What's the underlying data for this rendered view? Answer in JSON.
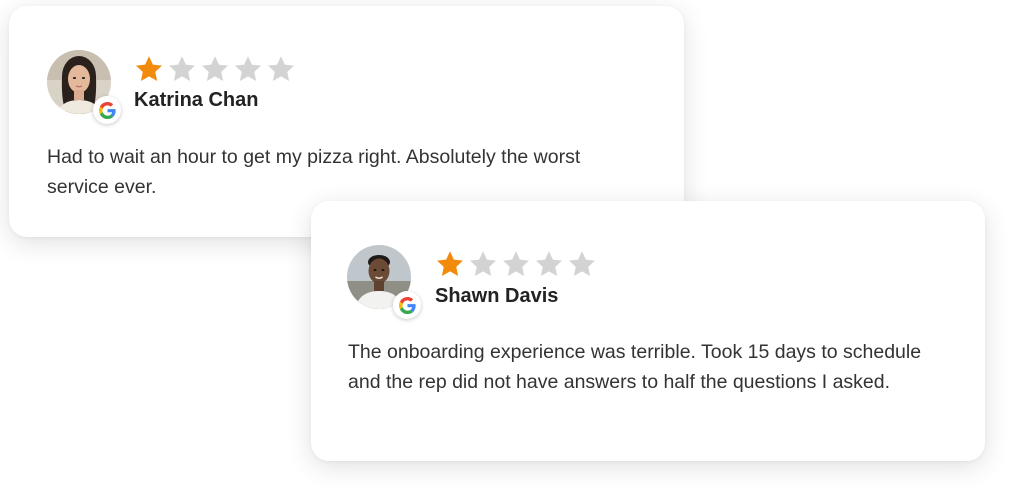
{
  "colors": {
    "star_filled": "#F28B0C",
    "star_empty": "#D3D3D3",
    "text": "#333333",
    "name": "#222222"
  },
  "reviews": [
    {
      "name": "Katrina Chan",
      "rating": 1,
      "max_rating": 5,
      "source_icon": "google-icon",
      "text": "Had to wait an hour to get my pizza right. Absolutely the worst service ever."
    },
    {
      "name": "Shawn Davis",
      "rating": 1,
      "max_rating": 5,
      "source_icon": "google-icon",
      "text": "The onboarding experience was terrible. Took 15 days to schedule and the rep did not have answers to half the questions I asked."
    }
  ]
}
